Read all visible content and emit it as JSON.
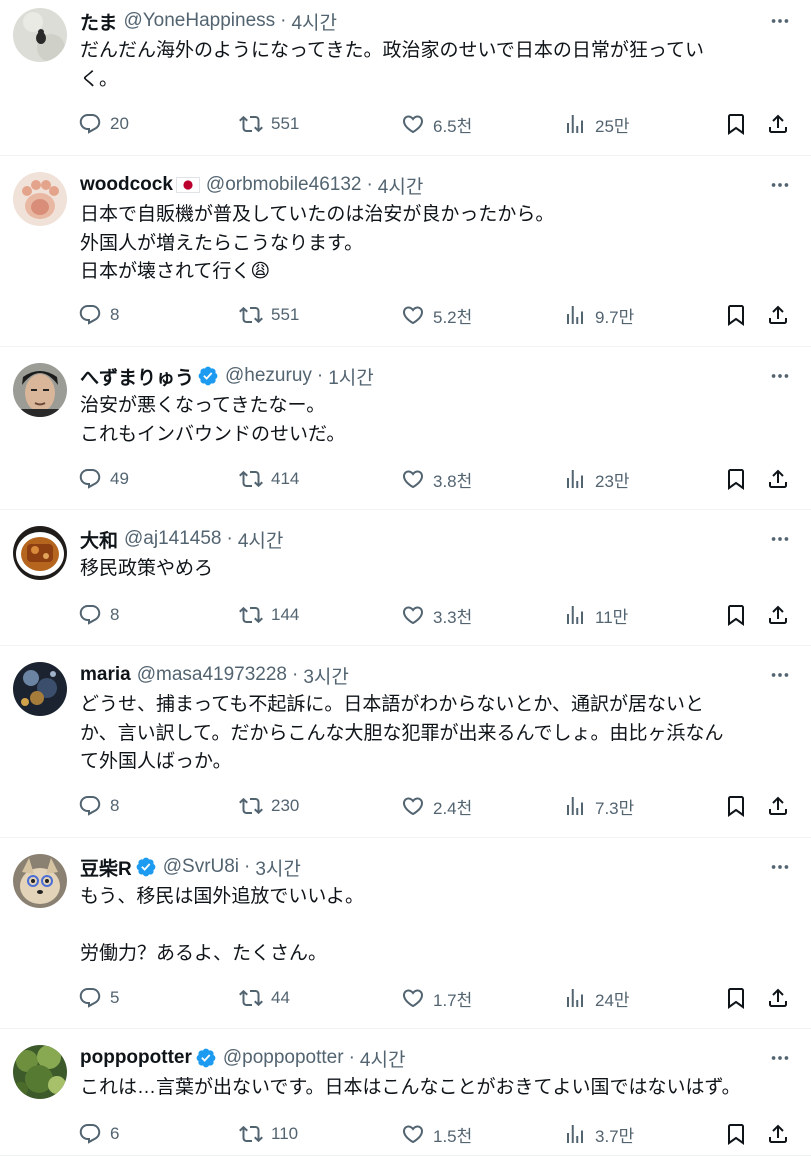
{
  "icons": {
    "reply": "reply-icon",
    "retweet": "retweet-icon",
    "like": "heart-icon",
    "views": "views-icon",
    "bookmark": "bookmark-icon",
    "share": "share-icon",
    "more": "more-icon",
    "verified": "verified-badge-icon",
    "flag": "japan-flag-icon"
  },
  "colors": {
    "verified": "#1d9bf0",
    "muted": "#536471",
    "text": "#0f1419"
  },
  "tweets": [
    {
      "name": "たま",
      "handle": "@YoneHappiness",
      "dot": "·",
      "time": "4시간",
      "verified": false,
      "flag": false,
      "text": "だんだん海外のようになってきた。政治家のせいで日本の日常が狂ってい\nく。",
      "replies": "20",
      "retweets": "551",
      "likes": "6.5천",
      "views": "25만"
    },
    {
      "name": "woodcock",
      "handle": "@orbmobile46132",
      "dot": "·",
      "time": "4시간",
      "verified": false,
      "flag": true,
      "text": "日本で自販機が普及していたのは治安が良かったから。\n外国人が増えたらこうなります。\n日本が壊されて行く😩",
      "replies": "8",
      "retweets": "551",
      "likes": "5.2천",
      "views": "9.7만"
    },
    {
      "name": "へずまりゅう",
      "handle": "@hezuruy",
      "dot": "·",
      "time": "1시간",
      "verified": true,
      "flag": false,
      "text": "治安が悪くなってきたなー。\nこれもインバウンドのせいだ。",
      "replies": "49",
      "retweets": "414",
      "likes": "3.8천",
      "views": "23만"
    },
    {
      "name": "大和",
      "handle": "@aj141458",
      "dot": "·",
      "time": "4시간",
      "verified": false,
      "flag": false,
      "text": "移民政策やめろ",
      "replies": "8",
      "retweets": "144",
      "likes": "3.3천",
      "views": "11만"
    },
    {
      "name": "maria",
      "handle": "@masa41973228",
      "dot": "·",
      "time": "3시간",
      "verified": false,
      "flag": false,
      "text": "どうせ、捕まっても不起訴に。日本語がわからないとか、通訳が居ないと\nか、言い訳して。だからこんな大胆な犯罪が出来るんでしょ。由比ヶ浜なん\nて外国人ばっか。",
      "replies": "8",
      "retweets": "230",
      "likes": "2.4천",
      "views": "7.3만"
    },
    {
      "name": "豆柴R",
      "handle": "@SvrU8i",
      "dot": "·",
      "time": "3시간",
      "verified": true,
      "flag": false,
      "text": "もう、移民は国外追放でいいよ。\n\n労働力？あるよ、たくさん。",
      "replies": "5",
      "retweets": "44",
      "likes": "1.7천",
      "views": "24만"
    },
    {
      "name": "poppopotter",
      "handle": "@poppopotter",
      "dot": "·",
      "time": "4시간",
      "verified": true,
      "flag": false,
      "text": "これは…言葉が出ないです。日本はこんなことがおきてよい国ではないはず。",
      "replies": "6",
      "retweets": "110",
      "likes": "1.5천",
      "views": "3.7만"
    }
  ]
}
